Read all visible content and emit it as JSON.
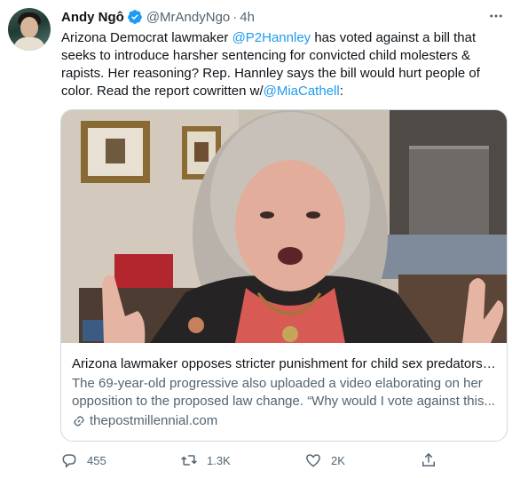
{
  "author": {
    "name": "Andy Ngô",
    "handle": "@MrAndyNgo",
    "separator": "·",
    "time": "4h"
  },
  "tweet": {
    "text_1": "Arizona Democrat lawmaker ",
    "mention_1": "@P2Hannley",
    "text_2": " has voted against a bill that seeks to introduce harsher sentencing for convicted child molesters & rapists. Her reasoning? Rep. Hannley says the bill would hurt people of color. Read the report cowritten w/",
    "mention_2": "@MiaCathell",
    "text_3": ":"
  },
  "card": {
    "title": "Arizona lawmaker opposes stricter punishment for child sex predators, ...",
    "description": "The 69-year-old progressive also uploaded a video elaborating on her opposition to the proposed law change. “Why would I vote against this...",
    "domain": "thepostmillennial.com"
  },
  "actions": {
    "replies": "455",
    "retweets": "1.3K",
    "likes": "2K"
  },
  "icons": {
    "verified": "verified-badge-icon",
    "more": "more-options-icon",
    "reply": "reply-icon",
    "retweet": "retweet-icon",
    "like": "heart-icon",
    "share": "share-icon",
    "link": "link-icon"
  },
  "colors": {
    "accent": "#1d9bf0",
    "text": "#0f1419",
    "muted": "#536471",
    "border": "#cfd9de"
  }
}
